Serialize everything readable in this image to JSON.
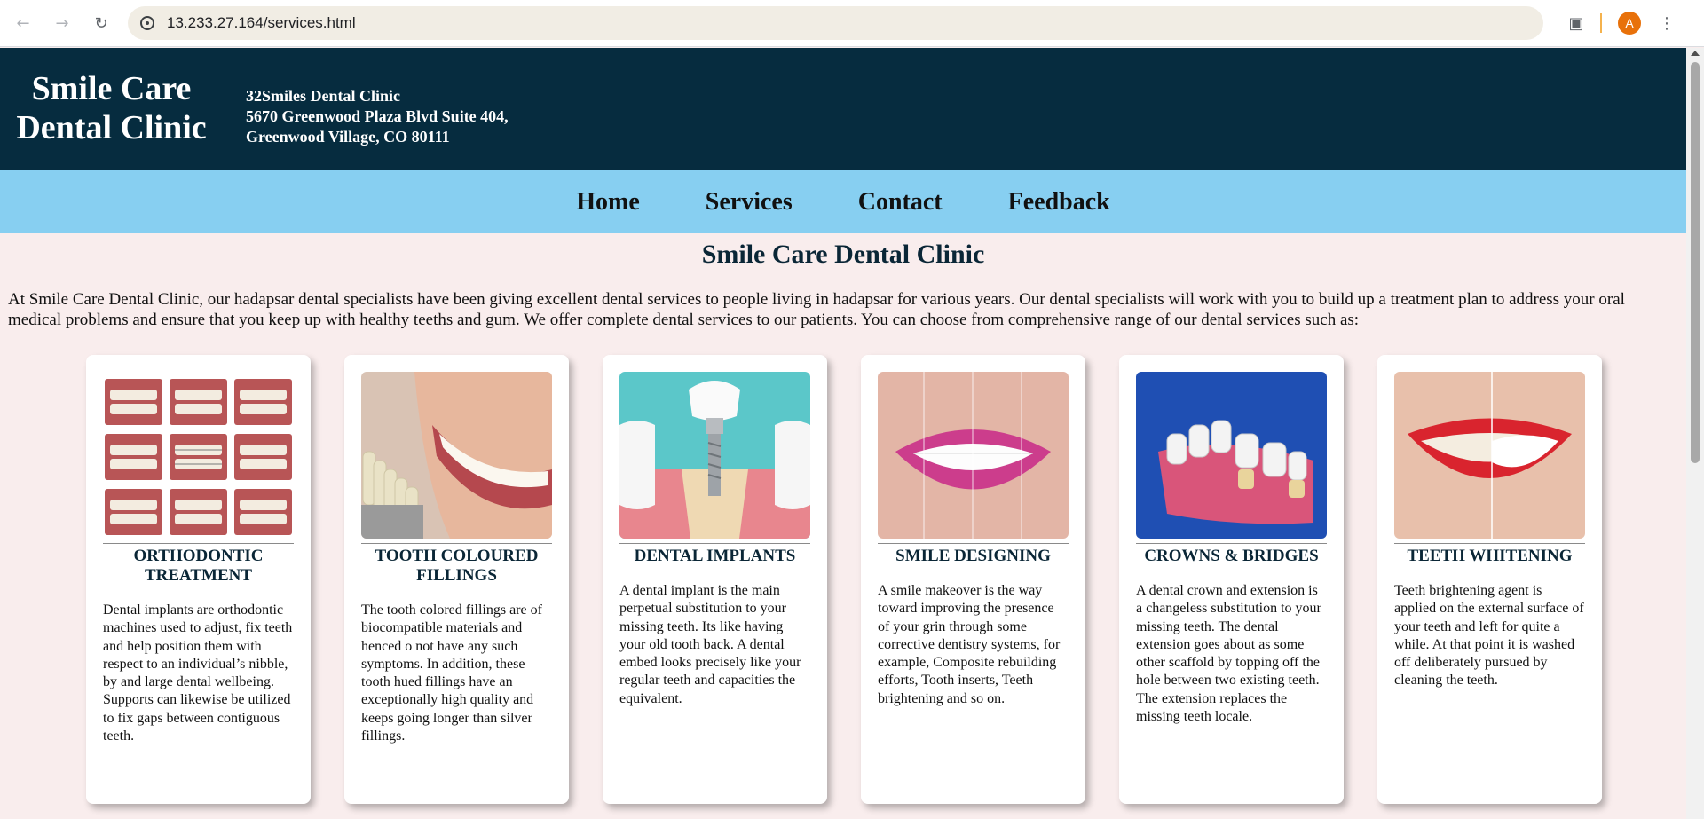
{
  "browser": {
    "url": "13.233.27.164/services.html",
    "avatar_letter": "A"
  },
  "header": {
    "logo": "Smile Care Dental Clinic",
    "address_lines": [
      "32Smiles Dental Clinic",
      "5670 Greenwood Plaza Blvd Suite 404,",
      "Greenwood Village, CO 80111"
    ]
  },
  "nav": {
    "items": [
      {
        "label": "Home"
      },
      {
        "label": "Services"
      },
      {
        "label": "Contact"
      },
      {
        "label": "Feedback"
      }
    ]
  },
  "main": {
    "title": "Smile Care Dental Clinic",
    "intro": "At Smile Care Dental Clinic, our hadapsar dental specialists have been giving excellent dental services to people living in hadapsar for various years. Our dental specialists will work with you to build up a treatment plan to address your oral medical problems and ensure that you keep up with healthy teeths and gum. We offer complete dental services to our patients. You can choose from comprehensive range of our dental services such as:"
  },
  "services": [
    {
      "title": "ORTHODONTIC TREATMENT",
      "text": "Dental implants are orthodontic machines used to adjust, fix teeth and help position them with respect to an individual’s nibble, by and large dental wellbeing. Supports can likewise be utilized to fix gaps between contiguous teeth."
    },
    {
      "title": "TOOTH COLOURED FILLINGS",
      "text": "The tooth colored fillings are of biocompatible materials and henced o not have any such symptoms. In addition, these tooth hued fillings have an exceptionally high quality and keeps going longer than silver fillings."
    },
    {
      "title": "DENTAL IMPLANTS",
      "text": "A dental implant is the main perpetual substitution to your missing teeth. Its like having your old tooth back. A dental embed looks precisely like your regular teeth and capacities the equivalent."
    },
    {
      "title": "SMILE DESIGNING",
      "text": "A smile makeover is the way toward improving the presence of your grin through some corrective dentistry systems, for example, Composite rebuilding efforts, Tooth inserts, Teeth brightening and so on."
    },
    {
      "title": "CROWNS & BRIDGES",
      "text": "A dental crown and extension is a changeless substitution to your missing teeth. The dental extension goes about as some other scaffold by topping off the hole between two existing teeth. The extension replaces the missing teeth locale."
    },
    {
      "title": "TEETH WHITENING",
      "text": "Teeth brightening agent is applied on the external surface of your teeth and left for quite a while. At that point it is washed off deliberately pursued by cleaning the teeth."
    }
  ]
}
